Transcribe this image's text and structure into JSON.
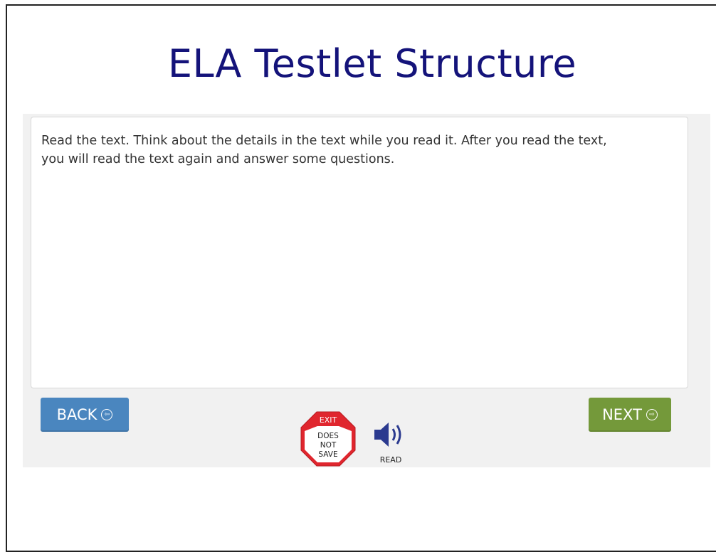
{
  "slide": {
    "title": "ELA Testlet Structure"
  },
  "content": {
    "instruction_line1": "Read the text. Think about the details in the text while you read it. After you read the text,",
    "instruction_line2": "you will read the text again and answer some questions."
  },
  "nav": {
    "back_label": "BACK",
    "next_label": "NEXT"
  },
  "tools": {
    "exit_top": "EXIT",
    "exit_line1": "DOES",
    "exit_line2": "NOT",
    "exit_line3": "SAVE",
    "read_label": "READ"
  },
  "colors": {
    "title": "#14137a",
    "back_button": "#4a86bf",
    "next_button": "#74993a",
    "exit_red": "#e0262e",
    "speaker_blue": "#2b3a8f"
  }
}
